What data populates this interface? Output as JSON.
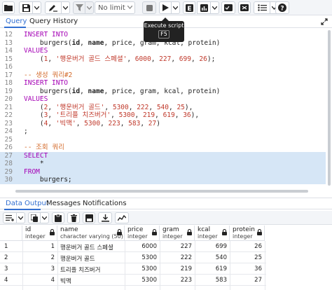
{
  "toolbar": {
    "limit_label": "No limit",
    "tooltip_title": "Execute script",
    "tooltip_key": "F5"
  },
  "query_tabs": [
    "Query",
    "Query History"
  ],
  "editor": {
    "lines": [
      {
        "n": "12",
        "parts": [
          {
            "t": "INSERT INTO",
            "c": "kw"
          }
        ]
      },
      {
        "n": "13",
        "parts": [
          {
            "t": "    burgers(",
            "c": ""
          },
          {
            "t": "id",
            "c": "bold"
          },
          {
            "t": ", ",
            "c": ""
          },
          {
            "t": "name",
            "c": "bold"
          },
          {
            "t": ", price, gram, kcal, protein)",
            "c": ""
          }
        ]
      },
      {
        "n": "14",
        "parts": [
          {
            "t": "VALUES",
            "c": "kw"
          }
        ]
      },
      {
        "n": "15",
        "parts": [
          {
            "t": "    (",
            "c": ""
          },
          {
            "t": "1",
            "c": "num"
          },
          {
            "t": ", ",
            "c": ""
          },
          {
            "t": "'행운버거 골드 스페셜'",
            "c": "str"
          },
          {
            "t": ", ",
            "c": ""
          },
          {
            "t": "6000",
            "c": "num"
          },
          {
            "t": ", ",
            "c": ""
          },
          {
            "t": "227",
            "c": "num"
          },
          {
            "t": ", ",
            "c": ""
          },
          {
            "t": "699",
            "c": "num"
          },
          {
            "t": ", ",
            "c": ""
          },
          {
            "t": "26",
            "c": "num"
          },
          {
            "t": ");",
            "c": ""
          }
        ]
      },
      {
        "n": "16",
        "parts": []
      },
      {
        "n": "17",
        "parts": [
          {
            "t": "-- 생성 쿼리#2",
            "c": "cmt"
          }
        ]
      },
      {
        "n": "18",
        "parts": [
          {
            "t": "INSERT INTO",
            "c": "kw"
          }
        ]
      },
      {
        "n": "19",
        "parts": [
          {
            "t": "    burgers(",
            "c": ""
          },
          {
            "t": "id",
            "c": "bold"
          },
          {
            "t": ", ",
            "c": ""
          },
          {
            "t": "name",
            "c": "bold"
          },
          {
            "t": ", price, gram, kcal, protein)",
            "c": ""
          }
        ]
      },
      {
        "n": "20",
        "parts": [
          {
            "t": "VALUES",
            "c": "kw"
          }
        ]
      },
      {
        "n": "21",
        "parts": [
          {
            "t": "    (",
            "c": ""
          },
          {
            "t": "2",
            "c": "num"
          },
          {
            "t": ", ",
            "c": ""
          },
          {
            "t": "'행운버거 골드'",
            "c": "str"
          },
          {
            "t": ", ",
            "c": ""
          },
          {
            "t": "5300",
            "c": "num"
          },
          {
            "t": ", ",
            "c": ""
          },
          {
            "t": "222",
            "c": "num"
          },
          {
            "t": ", ",
            "c": ""
          },
          {
            "t": "540",
            "c": "num"
          },
          {
            "t": ", ",
            "c": ""
          },
          {
            "t": "25",
            "c": "num"
          },
          {
            "t": "),",
            "c": ""
          }
        ]
      },
      {
        "n": "22",
        "parts": [
          {
            "t": "    (",
            "c": ""
          },
          {
            "t": "3",
            "c": "num"
          },
          {
            "t": ", ",
            "c": ""
          },
          {
            "t": "'트리플 치즈버거'",
            "c": "str"
          },
          {
            "t": ", ",
            "c": ""
          },
          {
            "t": "5300",
            "c": "num"
          },
          {
            "t": ", ",
            "c": ""
          },
          {
            "t": "219",
            "c": "num"
          },
          {
            "t": ", ",
            "c": ""
          },
          {
            "t": "619",
            "c": "num"
          },
          {
            "t": ", ",
            "c": ""
          },
          {
            "t": "36",
            "c": "num"
          },
          {
            "t": "),",
            "c": ""
          }
        ]
      },
      {
        "n": "23",
        "parts": [
          {
            "t": "    (",
            "c": ""
          },
          {
            "t": "4",
            "c": "num"
          },
          {
            "t": ", ",
            "c": ""
          },
          {
            "t": "'빅맥'",
            "c": "str"
          },
          {
            "t": ", ",
            "c": ""
          },
          {
            "t": "5300",
            "c": "num"
          },
          {
            "t": ", ",
            "c": ""
          },
          {
            "t": "223",
            "c": "num"
          },
          {
            "t": ", ",
            "c": ""
          },
          {
            "t": "583",
            "c": "num"
          },
          {
            "t": ", ",
            "c": ""
          },
          {
            "t": "27",
            "c": "num"
          },
          {
            "t": ")",
            "c": ""
          }
        ]
      },
      {
        "n": "24",
        "parts": [
          {
            "t": ";",
            "c": ""
          }
        ]
      },
      {
        "n": "25",
        "parts": []
      },
      {
        "n": "26",
        "parts": [
          {
            "t": "-- 조회 쿼리",
            "c": "cmt"
          }
        ]
      },
      {
        "n": "27",
        "sel": true,
        "parts": [
          {
            "t": "SELECT",
            "c": "kw"
          }
        ]
      },
      {
        "n": "28",
        "sel": true,
        "parts": [
          {
            "t": "    *",
            "c": ""
          }
        ]
      },
      {
        "n": "29",
        "sel": true,
        "parts": [
          {
            "t": "FROM",
            "c": "kw"
          }
        ]
      },
      {
        "n": "30",
        "sel": true,
        "parts": [
          {
            "t": "    burgers;",
            "c": ""
          }
        ]
      }
    ]
  },
  "bottom_tabs": [
    "Data Output",
    "Messages",
    "Notifications"
  ],
  "columns": [
    {
      "name": "id",
      "type": "integer"
    },
    {
      "name": "name",
      "type": "character varying (50)"
    },
    {
      "name": "price",
      "type": "integer"
    },
    {
      "name": "gram",
      "type": "integer"
    },
    {
      "name": "kcal",
      "type": "integer"
    },
    {
      "name": "protein",
      "type": "integer"
    }
  ],
  "rows": [
    {
      "rownum": "1",
      "id": "1",
      "name": "행운버거 골드 스페셜",
      "price": "6000",
      "gram": "227",
      "kcal": "699",
      "protein": "26"
    },
    {
      "rownum": "2",
      "id": "2",
      "name": "행운버거 골드",
      "price": "5300",
      "gram": "222",
      "kcal": "540",
      "protein": "25"
    },
    {
      "rownum": "3",
      "id": "3",
      "name": "트리플 치즈버거",
      "price": "5300",
      "gram": "219",
      "kcal": "619",
      "protein": "36"
    },
    {
      "rownum": "4",
      "id": "4",
      "name": "빅맥",
      "price": "5300",
      "gram": "223",
      "kcal": "583",
      "protein": "27"
    }
  ]
}
